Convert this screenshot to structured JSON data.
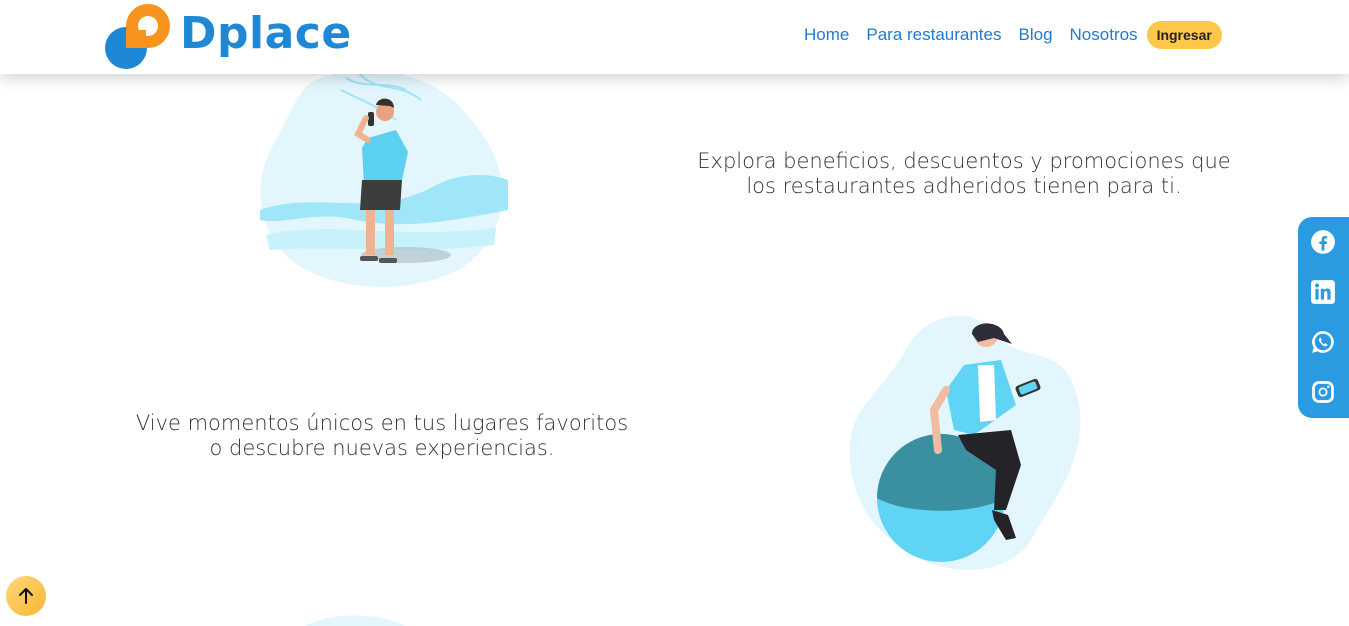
{
  "brand": {
    "name": "Dplace"
  },
  "nav": {
    "items": [
      "Home",
      "Para restaurantes",
      "Blog",
      "Nosotros"
    ],
    "login_label": "Ingresar"
  },
  "features": [
    {
      "text": "Explora beneficios, descuentos y promociones que los restaurantes adheridos tienen para ti."
    },
    {
      "text": "Vive momentos únicos en tus lugares favoritos o descubre nuevas experiencias."
    }
  ],
  "social": [
    "facebook-icon",
    "linkedin-icon",
    "whatsapp-icon",
    "instagram-icon"
  ],
  "colors": {
    "brand_blue": "#1e88d6",
    "brand_orange": "#f7941d",
    "login_yellow": "#ffc84a",
    "social_bar": "#2a9be0",
    "illustration_light": "#e3f6fd",
    "illustration_accent": "#5fd4f4"
  }
}
